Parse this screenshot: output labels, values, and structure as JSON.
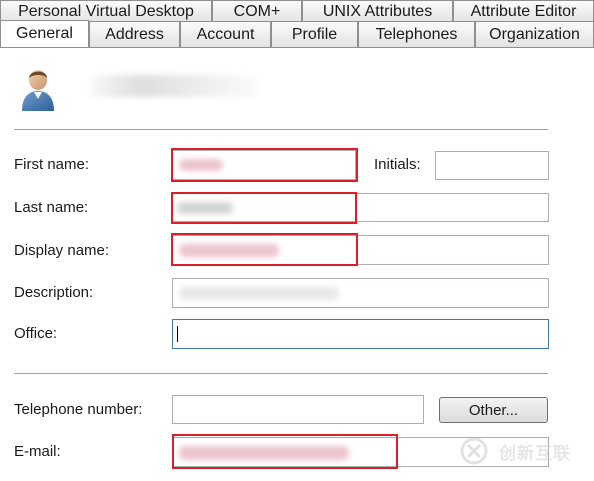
{
  "tabs": {
    "back_row": [
      "Personal Virtual Desktop",
      "COM+",
      "UNIX Attributes",
      "Attribute Editor"
    ],
    "front_row": [
      "General",
      "Address",
      "Account",
      "Profile",
      "Telephones",
      "Organization"
    ],
    "active": "General"
  },
  "form": {
    "first_name_label": "First name:",
    "initials_label": "Initials:",
    "initials_value": "",
    "last_name_label": "Last name:",
    "display_name_label": "Display name:",
    "description_label": "Description:",
    "office_label": "Office:",
    "office_value": "",
    "telephone_label": "Telephone number:",
    "telephone_value": "",
    "other_button": "Other...",
    "email_label": "E-mail:"
  },
  "icons": {
    "avatar": "user-icon",
    "watermark": "chuangxin-logo-icon"
  },
  "colors": {
    "highlight_border": "#d9202a",
    "focused_border": "#3d7bad"
  },
  "watermark": {
    "text": "创新互联"
  }
}
